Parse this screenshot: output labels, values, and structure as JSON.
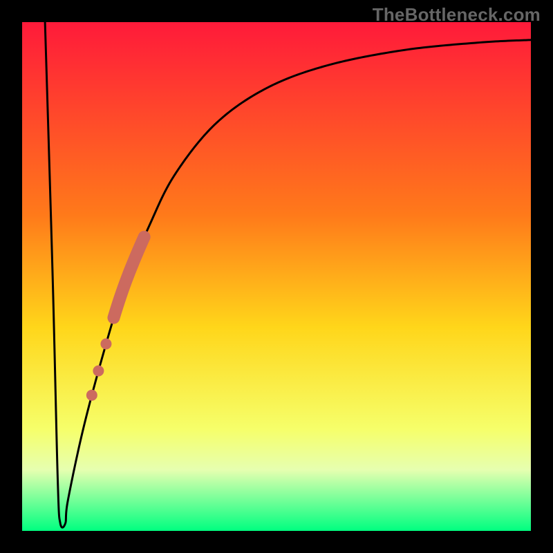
{
  "watermark": "TheBottleneck.com",
  "colors": {
    "background": "#000000",
    "curve": "#000000",
    "marker_fill": "#cc6a5f",
    "gradient": {
      "top": "#ff1a3a",
      "mid1": "#ff7a1a",
      "mid2": "#ffd61a",
      "mid3": "#f6ff6a",
      "bottom": "#00ff80"
    }
  },
  "chart_data": {
    "type": "line",
    "title": "",
    "xlabel": "",
    "ylabel": "",
    "x_range": [
      0,
      100
    ],
    "y_range": [
      0,
      100
    ],
    "optimal_x": 8,
    "curve": [
      {
        "x": 4.5,
        "y": 100
      },
      {
        "x": 6.0,
        "y": 50
      },
      {
        "x": 7.0,
        "y": 10
      },
      {
        "x": 7.5,
        "y": 1.5
      },
      {
        "x": 8.5,
        "y": 1.5
      },
      {
        "x": 9.0,
        "y": 6
      },
      {
        "x": 12,
        "y": 20
      },
      {
        "x": 16,
        "y": 35
      },
      {
        "x": 20,
        "y": 48
      },
      {
        "x": 25,
        "y": 60
      },
      {
        "x": 30,
        "y": 70
      },
      {
        "x": 38,
        "y": 80
      },
      {
        "x": 48,
        "y": 87
      },
      {
        "x": 60,
        "y": 91.5
      },
      {
        "x": 75,
        "y": 94.5
      },
      {
        "x": 90,
        "y": 96
      },
      {
        "x": 100,
        "y": 96.5
      }
    ],
    "marker_band": {
      "x_start": 18,
      "x_end": 24
    },
    "marker_dots": [
      {
        "x": 16.5
      },
      {
        "x": 15.0
      },
      {
        "x": 13.7
      }
    ]
  }
}
